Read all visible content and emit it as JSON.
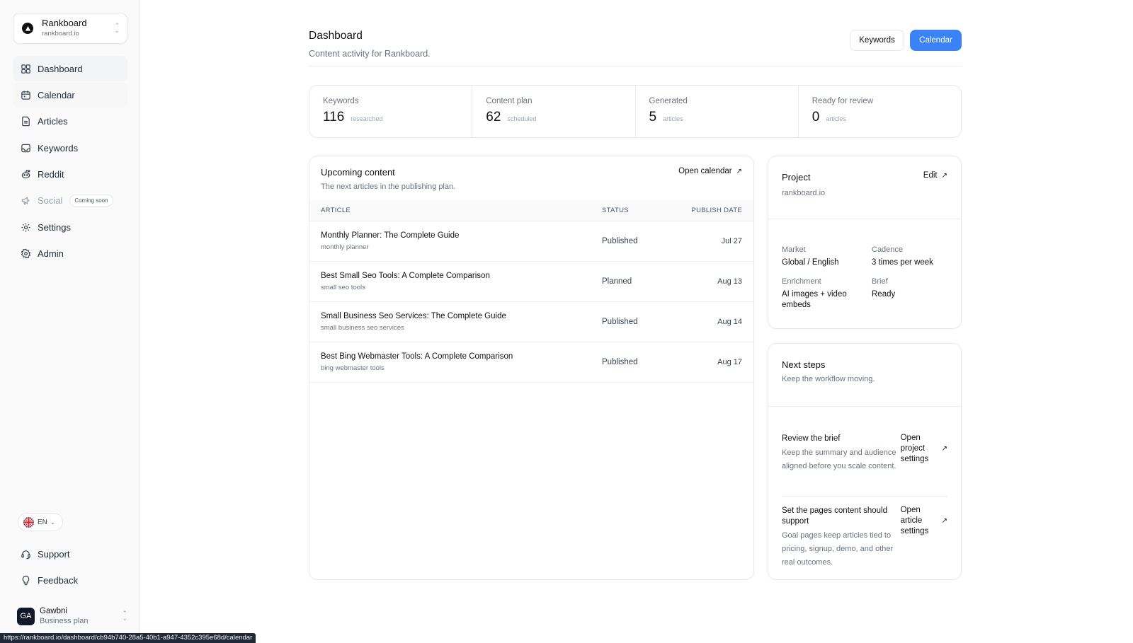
{
  "workspace": {
    "name": "Rankboard",
    "domain": "rankboard.io"
  },
  "sidebar": {
    "items": [
      {
        "label": "Dashboard",
        "icon": "grid-icon"
      },
      {
        "label": "Calendar",
        "icon": "calendar-icon"
      },
      {
        "label": "Articles",
        "icon": "document-icon"
      },
      {
        "label": "Keywords",
        "icon": "inbox-icon"
      },
      {
        "label": "Reddit",
        "icon": "reddit-icon"
      },
      {
        "label": "Social",
        "icon": "megaphone-icon",
        "badge": "Coming soon"
      },
      {
        "label": "Settings",
        "icon": "gear-icon"
      },
      {
        "label": "Admin",
        "icon": "admin-gear-icon"
      }
    ],
    "language": "EN",
    "bottom_items": [
      {
        "label": "Support",
        "icon": "headset-icon"
      },
      {
        "label": "Feedback",
        "icon": "lightbulb-icon"
      }
    ],
    "user": {
      "initials": "GA",
      "name": "Gawbni",
      "plan": "Business plan"
    }
  },
  "status_url": "https://rankboard.io/dashboard/cb94b740-28a5-40b1-a947-4352c395e68d/calendar",
  "header": {
    "title": "Dashboard",
    "subtitle": "Content activity for Rankboard.",
    "keywords_button": "Keywords",
    "calendar_button": "Calendar"
  },
  "stats": [
    {
      "label": "Keywords",
      "value": "116",
      "sub": "researched"
    },
    {
      "label": "Content plan",
      "value": "62",
      "sub": "scheduled"
    },
    {
      "label": "Generated",
      "value": "5",
      "sub": "articles"
    },
    {
      "label": "Ready for review",
      "value": "0",
      "sub": "articles"
    }
  ],
  "upcoming": {
    "title": "Upcoming content",
    "subtitle": "The next articles in the publishing plan.",
    "link": "Open calendar",
    "columns": {
      "article": "ARTICLE",
      "status": "STATUS",
      "date": "PUBLISH DATE"
    },
    "rows": [
      {
        "title": "Monthly Planner: The Complete Guide",
        "keyword": "monthly planner",
        "status": "Published",
        "date": "Jul 27"
      },
      {
        "title": "Best Small Seo Tools: A Complete Comparison",
        "keyword": "small seo tools",
        "status": "Planned",
        "date": "Aug 13"
      },
      {
        "title": "Small Business Seo Services: The Complete Guide",
        "keyword": "small business seo services",
        "status": "Published",
        "date": "Aug 14"
      },
      {
        "title": "Best Bing Webmaster Tools: A Complete Comparison",
        "keyword": "bing webmaster tools",
        "status": "Published",
        "date": "Aug 17"
      }
    ]
  },
  "project": {
    "title": "Project",
    "edit": "Edit",
    "domain": "rankboard.io",
    "market_label": "Market",
    "market": "Global / English",
    "cadence_label": "Cadence",
    "cadence": "3 times per week",
    "enrichment_label": "Enrichment",
    "enrichment": "AI images + video embeds",
    "brief_label": "Brief",
    "brief": "Ready"
  },
  "next_steps": {
    "title": "Next steps",
    "subtitle": "Keep the workflow moving.",
    "steps": [
      {
        "title": "Review the brief",
        "desc": "Keep the summary and audience aligned before you scale content.",
        "link": "Open project settings"
      },
      {
        "title": "Set the pages content should support",
        "desc": "Goal pages keep articles tied to pricing, signup, demo, and other real outcomes.",
        "link": "Open article settings"
      }
    ]
  },
  "colors": {
    "primary": "#3b82f6",
    "text": "#111827",
    "muted": "#6b7280",
    "border": "#e5e7eb"
  }
}
